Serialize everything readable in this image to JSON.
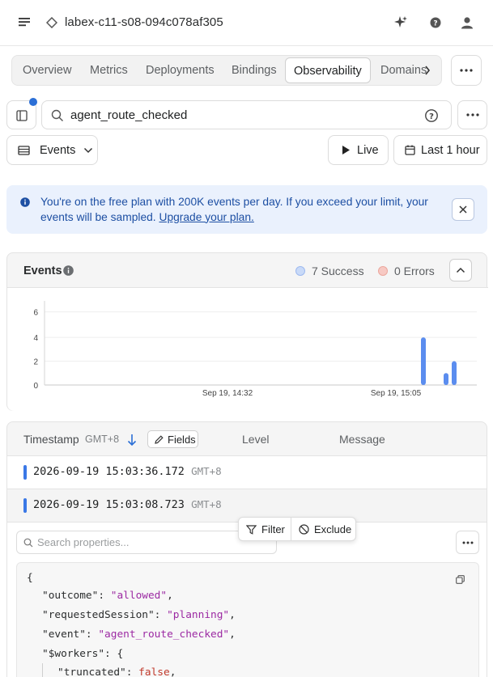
{
  "header": {
    "title": "labex-c11-s08-094c078af305"
  },
  "tabs": [
    {
      "label": "Overview"
    },
    {
      "label": "Metrics"
    },
    {
      "label": "Deployments"
    },
    {
      "label": "Bindings"
    },
    {
      "label": "Observability"
    },
    {
      "label": "Domains"
    }
  ],
  "search": {
    "query": "agent_route_checked"
  },
  "toolbar": {
    "view_label": "Events",
    "live_label": "Live",
    "range_label": "Last 1 hour"
  },
  "banner": {
    "text": "You're on the free plan with 200K events per day. If you exceed your limit, your events will be sampled.",
    "link": "Upgrade your plan."
  },
  "events_panel": {
    "title": "Events",
    "success_label": "7 Success",
    "errors_label": "0 Errors"
  },
  "colors": {
    "success": "#5b8def",
    "errors": "#f0a39a",
    "accent": "#2b6fd6"
  },
  "chart_data": {
    "type": "bar",
    "y_ticks": [
      "6",
      "4",
      "2",
      "0"
    ],
    "ylim": [
      0,
      6
    ],
    "x_tick_labels": [
      "Sep 19, 14:32",
      "Sep 19, 15:05"
    ],
    "series": [
      {
        "name": "Success",
        "values": [
          4,
          1,
          2
        ]
      }
    ]
  },
  "table": {
    "headers": {
      "timestamp": "Timestamp",
      "tz": "GMT+8",
      "fields": "Fields",
      "level": "Level",
      "message": "Message"
    },
    "rows": [
      {
        "timestamp": "2026-09-19 15:03:36.172",
        "tz": "GMT+8"
      },
      {
        "timestamp": "2026-09-19 15:03:08.723",
        "tz": "GMT+8"
      }
    ]
  },
  "popover": {
    "filter": "Filter",
    "exclude": "Exclude"
  },
  "details": {
    "search_placeholder": "Search properties...",
    "json_lines": {
      "open": "{",
      "outcome_key": "\"outcome\": ",
      "outcome_val": "\"allowed\"",
      "session_key": "\"requestedSession\": ",
      "session_val": "\"planning\"",
      "event_key": "\"event\": ",
      "event_val": "\"agent_route_checked\"",
      "workers_key": "\"$workers\": {",
      "truncated_key": "\"truncated\": ",
      "truncated_val": "false"
    }
  }
}
